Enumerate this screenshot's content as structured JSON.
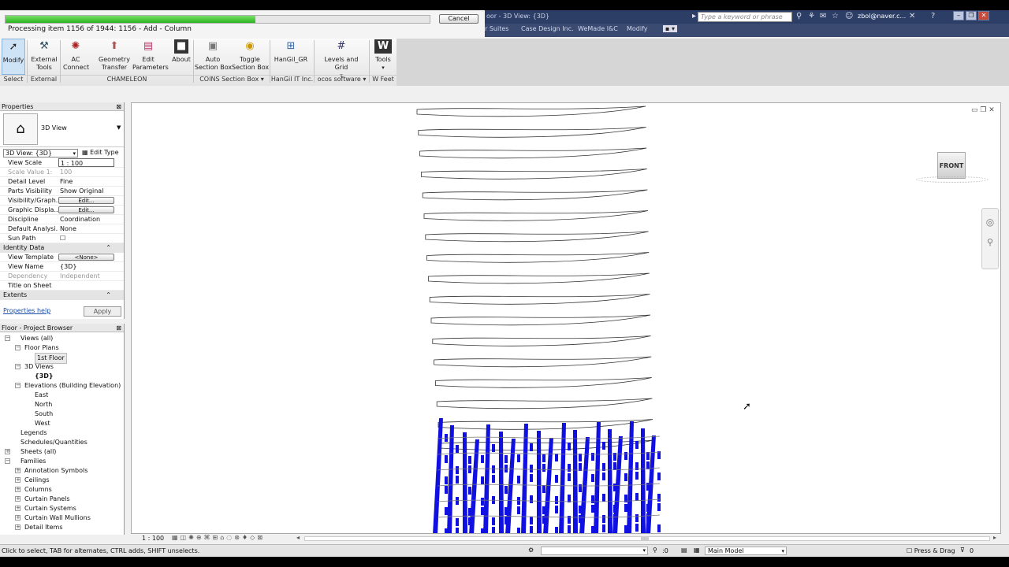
{
  "progress": {
    "text": "Processing item 1156 of 1944: 1156 - Add - Column",
    "fraction": 0.59,
    "cancel_label": "Cancel"
  },
  "titlebar": {
    "title": "oor - 3D View: {3D}",
    "search_placeholder": "Type a keyword or phrase",
    "user": "zbol@naver.c..."
  },
  "tabs": [
    {
      "label": "r Suites"
    },
    {
      "label": "Case Design Inc."
    },
    {
      "label": "WeMade I&C"
    },
    {
      "label": "Modify"
    }
  ],
  "ribbon": {
    "buttons": [
      {
        "label": "Modify",
        "icon": "cursor-arrow-icon"
      },
      {
        "label": "External\nTools",
        "icon": "tools-icon"
      },
      {
        "label": "AC\nConnect",
        "icon": "connect-icon"
      },
      {
        "label": "Geometry\nTransfer",
        "icon": "transfer-icon"
      },
      {
        "label": "Edit\nParameters",
        "icon": "parameters-icon"
      },
      {
        "label": "About",
        "icon": "about-icon"
      },
      {
        "label": "Auto\nSection Box",
        "icon": "section-box-icon"
      },
      {
        "label": "Toggle\nSection Box",
        "icon": "toggle-icon"
      },
      {
        "label": "HanGil_GR",
        "icon": "grid-icon"
      },
      {
        "label": "Levels and Grid",
        "icon": "levels-icon"
      },
      {
        "label": "Tools",
        "icon": "w-tools-icon"
      }
    ],
    "panels": [
      {
        "label": "Select"
      },
      {
        "label": "External"
      },
      {
        "label": "CHAMELEON"
      },
      {
        "label": "COINS Section Box ▾"
      },
      {
        "label": "HanGil IT Inc."
      },
      {
        "label": "ocos software ▾"
      },
      {
        "label": "W Feet"
      }
    ]
  },
  "properties": {
    "header": "Properties",
    "type_name": "3D View",
    "selector": "3D View: {3D}",
    "edit_type": "Edit Type",
    "rows": [
      {
        "k": "View Scale",
        "v": "1 : 100"
      },
      {
        "k": "Scale Value    1:",
        "v": "100",
        "grey": true
      },
      {
        "k": "Detail Level",
        "v": "Fine"
      },
      {
        "k": "Parts Visibility",
        "v": "Show Original"
      },
      {
        "k": "Visibility/Graph...",
        "v": "Edit...",
        "btn": true
      },
      {
        "k": "Graphic Displa...",
        "v": "Edit...",
        "btn": true
      },
      {
        "k": "Discipline",
        "v": "Coordination"
      },
      {
        "k": "Default Analysi...",
        "v": "None"
      },
      {
        "k": "Sun Path",
        "v": "☐"
      }
    ],
    "section1": "Identity Data",
    "rows2": [
      {
        "k": "View Template",
        "v": "<None>",
        "btn": true
      },
      {
        "k": "View Name",
        "v": "{3D}"
      },
      {
        "k": "Dependency",
        "v": "Independent",
        "grey": true
      },
      {
        "k": "Title on Sheet",
        "v": ""
      }
    ],
    "section2": "Extents",
    "help": "Properties help",
    "apply": "Apply"
  },
  "browser": {
    "header": "Floor - Project Browser",
    "nodes": [
      {
        "label": "Views (all)",
        "level": 0,
        "exp": "−"
      },
      {
        "label": "Floor Plans",
        "level": 1,
        "exp": "−"
      },
      {
        "label": "1st Floor",
        "level": 2,
        "sel": true
      },
      {
        "label": "3D Views",
        "level": 1,
        "exp": "−"
      },
      {
        "label": "{3D}",
        "level": 2,
        "bold": true
      },
      {
        "label": "Elevations (Building Elevation)",
        "level": 1,
        "exp": "−"
      },
      {
        "label": "East",
        "level": 2
      },
      {
        "label": "North",
        "level": 2
      },
      {
        "label": "South",
        "level": 2
      },
      {
        "label": "West",
        "level": 2
      },
      {
        "label": "Legends",
        "level": 0
      },
      {
        "label": "Schedules/Quantities",
        "level": 0
      },
      {
        "label": "Sheets (all)",
        "level": 0,
        "exp": "+"
      },
      {
        "label": "Families",
        "level": 0,
        "exp": "−"
      },
      {
        "label": "Annotation Symbols",
        "level": 1,
        "exp": "+"
      },
      {
        "label": "Ceilings",
        "level": 1,
        "exp": "+"
      },
      {
        "label": "Columns",
        "level": 1,
        "exp": "+"
      },
      {
        "label": "Curtain Panels",
        "level": 1,
        "exp": "+"
      },
      {
        "label": "Curtain Systems",
        "level": 1,
        "exp": "+"
      },
      {
        "label": "Curtain Wall Mullions",
        "level": 1,
        "exp": "+"
      },
      {
        "label": "Detail Items",
        "level": 1,
        "exp": "+"
      }
    ]
  },
  "viewcube": {
    "label": "FRONT"
  },
  "view_status": {
    "scale": "1 : 100"
  },
  "status": {
    "hint": "Click to select, TAB for alternates, CTRL adds, SHIFT unselects.",
    "count": ":0",
    "model": "Main Model",
    "press_drag": "Press & Drag",
    "filter": "0"
  }
}
